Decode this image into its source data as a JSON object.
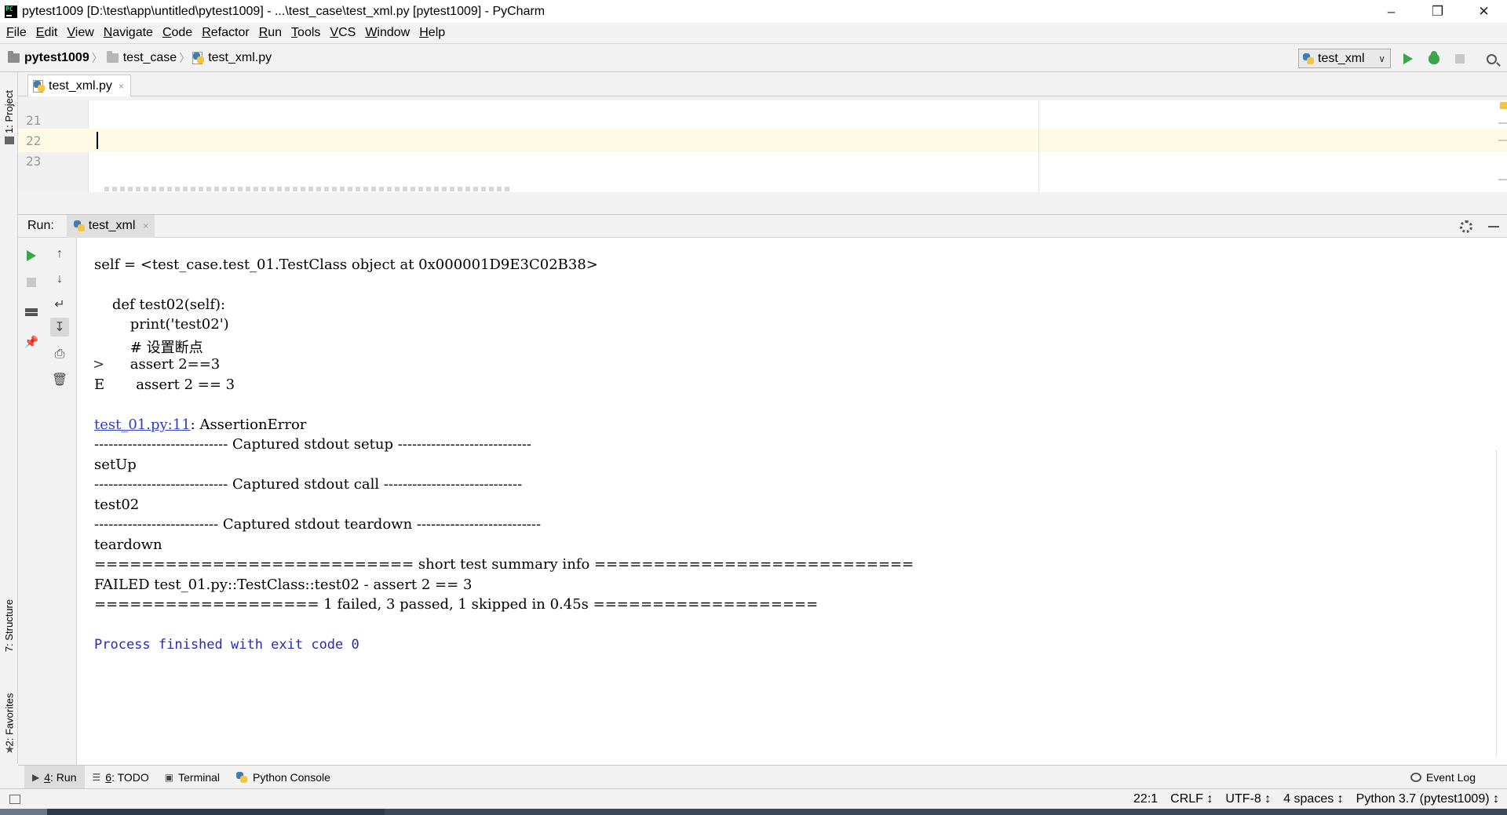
{
  "window": {
    "title": "pytest1009 [D:\\test\\app\\untitled\\pytest1009] - ...\\test_case\\test_xml.py [pytest1009] - PyCharm",
    "app_icon": "PC",
    "minimize": "–",
    "restore": "❐",
    "close": "✕"
  },
  "menu": [
    {
      "u": "F",
      "rest": "ile"
    },
    {
      "u": "E",
      "rest": "dit"
    },
    {
      "u": "V",
      "rest": "iew"
    },
    {
      "u": "N",
      "rest": "avigate"
    },
    {
      "u": "C",
      "rest": "ode"
    },
    {
      "u": "R",
      "rest": "efactor"
    },
    {
      "u": "R",
      "rest": "un"
    },
    {
      "u": "T",
      "rest": "ools"
    },
    {
      "u": "V",
      "rest": "CS"
    },
    {
      "u": "W",
      "rest": "indow"
    },
    {
      "u": "H",
      "rest": "elp"
    }
  ],
  "breadcrumb": {
    "project": "pytest1009",
    "folder": "test_case",
    "file": "test_xml.py"
  },
  "run_config": {
    "name": "test_xml",
    "chevron": "∨"
  },
  "left_strip": {
    "project": "1: Project",
    "structure": "7: Structure",
    "favorites": "2: Favorites"
  },
  "editor": {
    "tab": "test_xml.py",
    "tab_close": "×",
    "line_numbers": [
      "21",
      "22",
      "23"
    ]
  },
  "run_panel": {
    "label": "Run:",
    "tab": "test_xml",
    "tab_close": "×"
  },
  "console": {
    "lines": [
      "self = <test_case.test_01.TestClass object at 0x000001D9E3C02B38>",
      "",
      "    def test02(self):",
      "        print('test02')",
      "        # 设置断点",
      "        assert 2==3",
      "E       assert 2 == 3",
      "",
      "",
      "---------------------------- Captured stdout setup ----------------------------",
      "setUp",
      "---------------------------- Captured stdout call -----------------------------",
      "test02",
      "-------------------------- Captured stdout teardown --------------------------",
      "teardown",
      "=========================== short test summary info ===========================",
      "FAILED test_01.py::TestClass::test02 - assert 2 == 3",
      "=================== 1 failed, 3 passed, 1 skipped in 0.45s ===================",
      "",
      "Process finished with exit code 0"
    ],
    "arrow_mark": ">",
    "link_text": "test_01.py:11",
    "link_suffix": ": AssertionError"
  },
  "bottom_tabs": [
    {
      "num": "4",
      "label": ": Run"
    },
    {
      "num": "6",
      "label": ": TODO"
    },
    {
      "num": "",
      "label": "Terminal"
    },
    {
      "num": "",
      "label": "Python Console"
    }
  ],
  "event_log": "Event Log",
  "status": {
    "position": "22:1",
    "line_sep": "CRLF ↕",
    "encoding": "UTF-8 ↕",
    "indent": "4 spaces ↕",
    "interpreter": "Python 3.7 (pytest1009) ↕"
  }
}
